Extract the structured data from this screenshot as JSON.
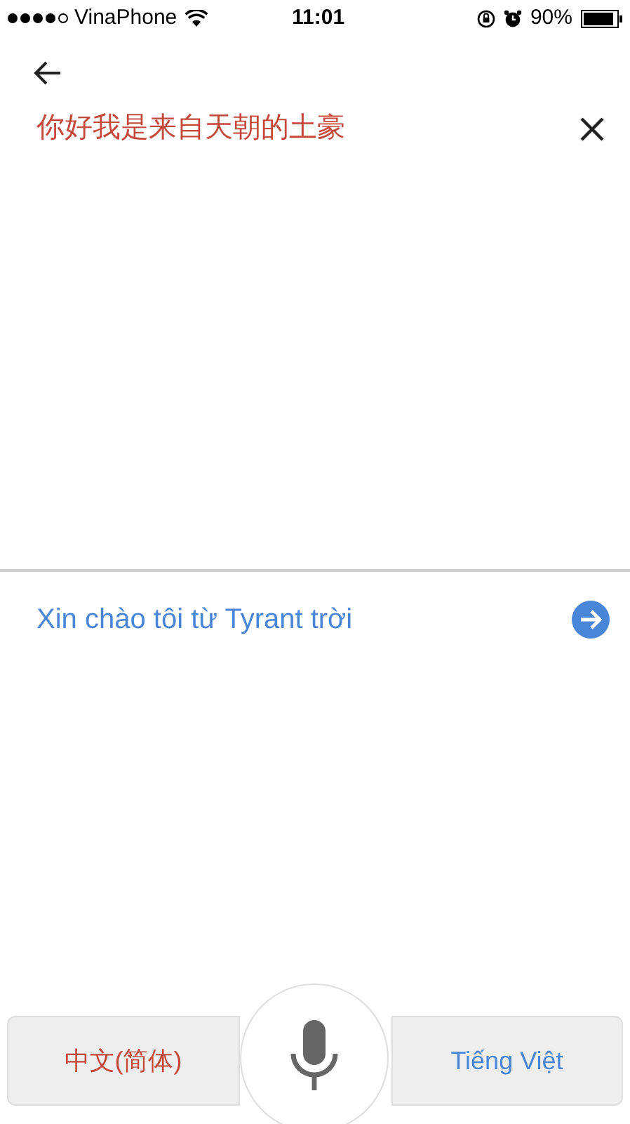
{
  "status_bar": {
    "carrier": "VinaPhone",
    "time": "11:01",
    "battery": "90%"
  },
  "source": {
    "text": "你好我是来自天朝的土豪"
  },
  "translation": {
    "text": "Xin chào tôi từ Tyrant trời"
  },
  "languages": {
    "source": "中文(简体)",
    "target": "Tiếng Việt"
  }
}
